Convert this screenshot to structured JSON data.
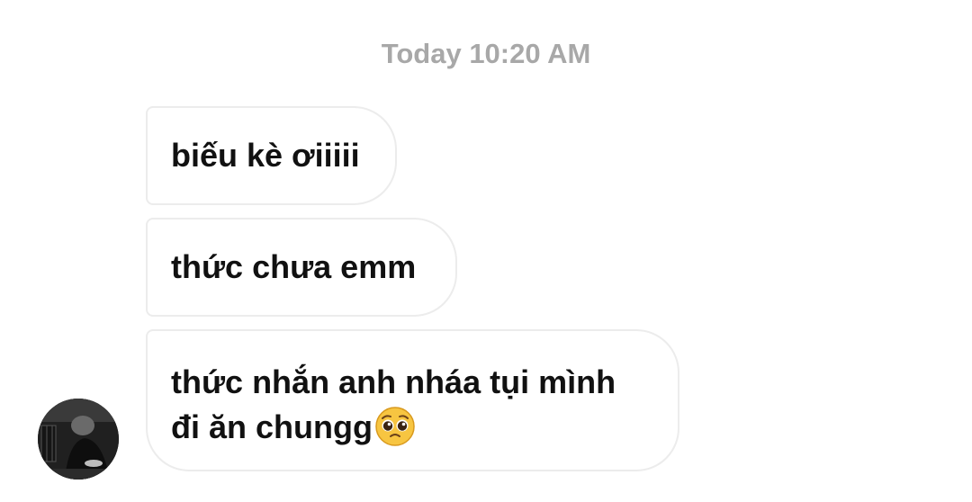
{
  "conversation": {
    "timestamp": "Today 10:20 AM",
    "messages": [
      {
        "text": "biếu kè ơiiiii"
      },
      {
        "text": "thức chưa emm"
      },
      {
        "line1": "thức nhắn anh nháa tụi mình",
        "line2": "đi ăn chungg",
        "emoji": "pleading-face-icon"
      }
    ]
  },
  "colors": {
    "timestamp": "#a8a8a8",
    "bubble_border": "#ececec",
    "message_text": "#111111",
    "emoji_face": "#f7c541"
  }
}
